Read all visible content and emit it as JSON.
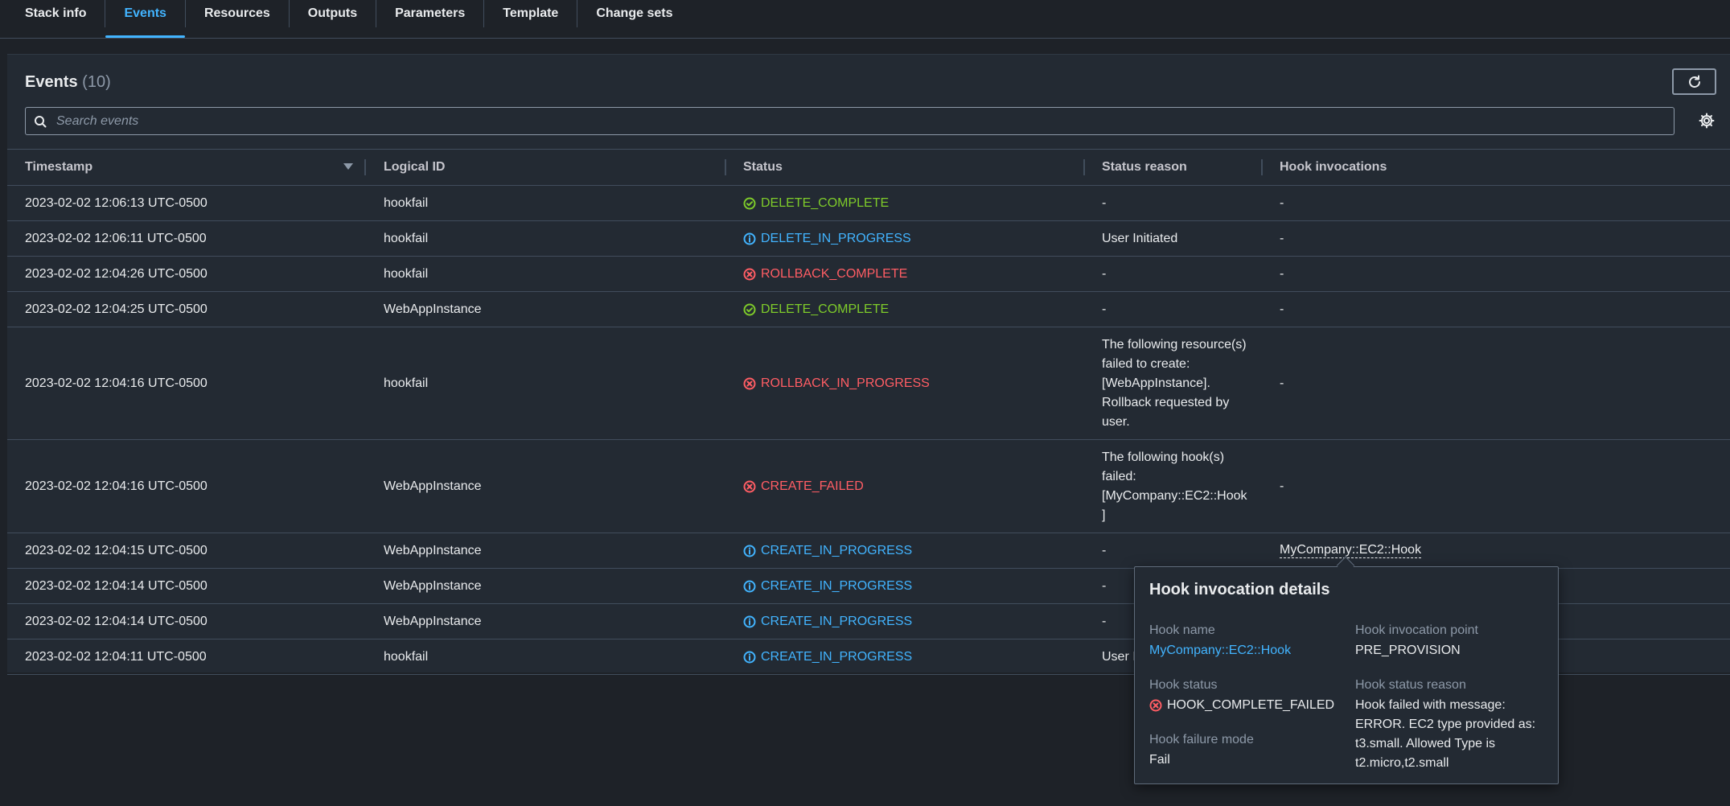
{
  "tabs": [
    {
      "label": "Stack info",
      "active": false
    },
    {
      "label": "Events",
      "active": true
    },
    {
      "label": "Resources",
      "active": false
    },
    {
      "label": "Outputs",
      "active": false
    },
    {
      "label": "Parameters",
      "active": false
    },
    {
      "label": "Template",
      "active": false
    },
    {
      "label": "Change sets",
      "active": false
    }
  ],
  "events_panel": {
    "title": "Events",
    "count": "(10)",
    "search_placeholder": "Search events",
    "refresh_icon": "refresh-icon",
    "settings_icon": "gear-icon"
  },
  "table": {
    "columns": [
      "Timestamp",
      "Logical ID",
      "Status",
      "Status reason",
      "Hook invocations"
    ],
    "sort_column": "Timestamp",
    "rows": [
      {
        "timestamp": "2023-02-02 12:06:13 UTC-0500",
        "logical_id": "hookfail",
        "status": "DELETE_COMPLETE",
        "status_type": "success",
        "reason": "-",
        "hook": "-"
      },
      {
        "timestamp": "2023-02-02 12:06:11 UTC-0500",
        "logical_id": "hookfail",
        "status": "DELETE_IN_PROGRESS",
        "status_type": "info",
        "reason": "User Initiated",
        "hook": "-"
      },
      {
        "timestamp": "2023-02-02 12:04:26 UTC-0500",
        "logical_id": "hookfail",
        "status": "ROLLBACK_COMPLETE",
        "status_type": "error",
        "reason": "-",
        "hook": "-"
      },
      {
        "timestamp": "2023-02-02 12:04:25 UTC-0500",
        "logical_id": "WebAppInstance",
        "status": "DELETE_COMPLETE",
        "status_type": "success",
        "reason": "-",
        "hook": "-"
      },
      {
        "timestamp": "2023-02-02 12:04:16 UTC-0500",
        "logical_id": "hookfail",
        "status": "ROLLBACK_IN_PROGRESS",
        "status_type": "error",
        "reason": "The following resource(s) failed to create: [WebAppInstance]. Rollback requested by user.",
        "hook": "-"
      },
      {
        "timestamp": "2023-02-02 12:04:16 UTC-0500",
        "logical_id": "WebAppInstance",
        "status": "CREATE_FAILED",
        "status_type": "error",
        "reason": "The following hook(s) failed: [MyCompany::EC2::Hook ]",
        "hook": "-"
      },
      {
        "timestamp": "2023-02-02 12:04:15 UTC-0500",
        "logical_id": "WebAppInstance",
        "status": "CREATE_IN_PROGRESS",
        "status_type": "info",
        "reason": "-",
        "hook": "MyCompany::EC2::Hook",
        "hook_is_link": true
      },
      {
        "timestamp": "2023-02-02 12:04:14 UTC-0500",
        "logical_id": "WebAppInstance",
        "status": "CREATE_IN_PROGRESS",
        "status_type": "info",
        "reason": "-",
        "hook": ""
      },
      {
        "timestamp": "2023-02-02 12:04:14 UTC-0500",
        "logical_id": "WebAppInstance",
        "status": "CREATE_IN_PROGRESS",
        "status_type": "info",
        "reason": "-",
        "hook": ""
      },
      {
        "timestamp": "2023-02-02 12:04:11 UTC-0500",
        "logical_id": "hookfail",
        "status": "CREATE_IN_PROGRESS",
        "status_type": "info",
        "reason": "User I",
        "hook": ""
      }
    ]
  },
  "popover": {
    "title": "Hook invocation details",
    "hook_name_label": "Hook name",
    "hook_name": "MyCompany::EC2::Hook",
    "invocation_point_label": "Hook invocation point",
    "invocation_point": "PRE_PROVISION",
    "status_label": "Hook status",
    "status": "HOOK_COMPLETE_FAILED",
    "status_reason_label": "Hook status reason",
    "status_reason": "Hook failed with message: ERROR. EC2 type provided as: t3.small. Allowed Type is t2.micro,t2.small",
    "failure_mode_label": "Hook failure mode",
    "failure_mode": "Fail"
  },
  "colors": {
    "background": "#1e2228",
    "panel": "#232a33",
    "accent": "#42b4ff",
    "success": "#7ecb2a",
    "error": "#ff5d64"
  }
}
